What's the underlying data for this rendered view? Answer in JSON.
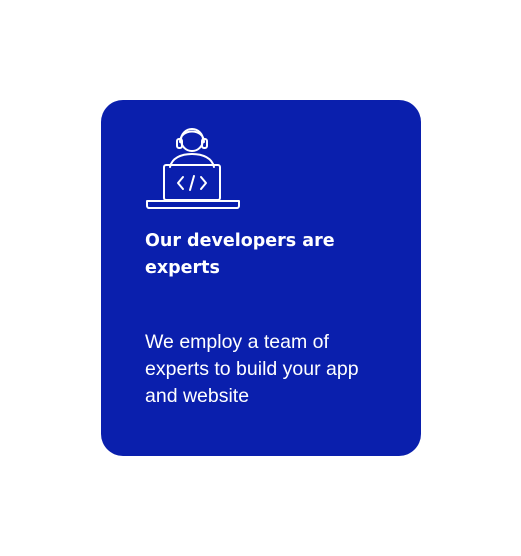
{
  "card": {
    "title": "Our developers are experts",
    "body": "We employ a team of experts to build your app and website",
    "icon": "developer-laptop-icon",
    "colors": {
      "card_background": "#0a1fad",
      "text": "#ffffff"
    }
  }
}
